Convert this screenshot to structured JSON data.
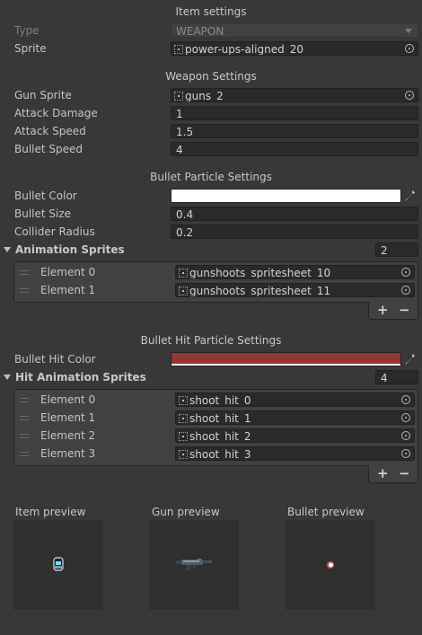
{
  "item_settings": {
    "header": "Item settings",
    "type_label": "Type",
    "type_value": "WEAPON",
    "sprite_label": "Sprite",
    "sprite_value": "power-ups-aligned_20"
  },
  "weapon_settings": {
    "header": "Weapon Settings",
    "gun_sprite_label": "Gun Sprite",
    "gun_sprite_value": "guns_2",
    "attack_damage_label": "Attack Damage",
    "attack_damage_value": "1",
    "attack_speed_label": "Attack Speed",
    "attack_speed_value": "1.5",
    "bullet_speed_label": "Bullet Speed",
    "bullet_speed_value": "4"
  },
  "bullet_particle": {
    "header": "Bullet Particle Settings",
    "bullet_color_label": "Bullet Color",
    "bullet_color": "#ffffff",
    "bullet_size_label": "Bullet Size",
    "bullet_size_value": "0.4",
    "collider_radius_label": "Collider Radius",
    "collider_radius_value": "0.2",
    "animation_sprites_label": "Animation Sprites",
    "animation_sprites_count": "2",
    "elements": [
      {
        "label": "Element 0",
        "value": "gunshoots_spritesheet_10"
      },
      {
        "label": "Element 1",
        "value": "gunshoots_spritesheet_11"
      }
    ],
    "add_label": "+",
    "remove_label": "−"
  },
  "bullet_hit": {
    "header": "Bullet Hit Particle Settings",
    "hit_color_label": "Bullet Hit Color",
    "hit_color": "#963535",
    "hit_animation_label": "Hit Animation Sprites",
    "hit_animation_count": "4",
    "elements": [
      {
        "label": "Element 0",
        "value": "shoot_hit_0"
      },
      {
        "label": "Element 1",
        "value": "shoot_hit_1"
      },
      {
        "label": "Element 2",
        "value": "shoot_hit_2"
      },
      {
        "label": "Element 3",
        "value": "shoot_hit_3"
      }
    ],
    "add_label": "+",
    "remove_label": "−"
  },
  "previews": {
    "item_label": "Item preview",
    "gun_label": "Gun preview",
    "bullet_label": "Bullet preview"
  }
}
